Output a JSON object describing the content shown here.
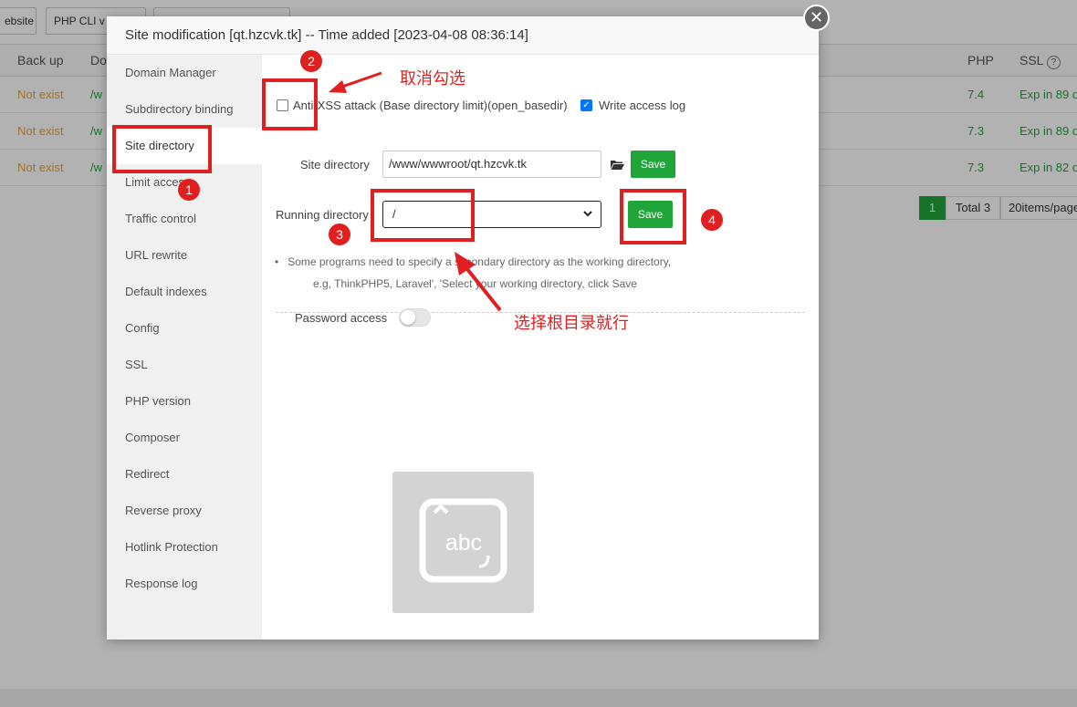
{
  "background": {
    "toolbar_buttons": [
      "ebsite",
      "PHP CLI v"
    ],
    "table_headers": [
      "Back up",
      "Do",
      "PHP",
      "SSL"
    ],
    "rows": [
      {
        "status": "Not exist",
        "dir": "/w",
        "php": "7.4",
        "ssl": "Exp in 89 d"
      },
      {
        "status": "Not exist",
        "dir": "/w",
        "php": "7.3",
        "ssl": "Exp in 89 d"
      },
      {
        "status": "Not exist",
        "dir": "/w",
        "php": "7.3",
        "ssl": "Exp in 82 d"
      }
    ],
    "pager": {
      "current": "1",
      "total": "Total 3",
      "page_size": "20items/page"
    }
  },
  "modal": {
    "title": "Site modification [qt.hzcvk.tk] -- Time added [2023-04-08 08:36:14]",
    "close_glyph": "✕",
    "sidebar": [
      "Domain Manager",
      "Subdirectory binding",
      "Site directory",
      "Limit access",
      "Traffic control",
      "URL rewrite",
      "Default indexes",
      "Config",
      "SSL",
      "PHP version",
      "Composer",
      "Redirect",
      "Reverse proxy",
      "Hotlink Protection",
      "Response log"
    ],
    "active_item": "Site directory",
    "anti_xss_label": "Anti-XSS attack (Base directory limit)(open_basedir)",
    "anti_xss_checked": false,
    "write_log_label": "Write access log",
    "write_log_checked": true,
    "site_directory_label": "Site directory",
    "site_directory_value": "/www/wwwroot/qt.hzcvk.tk",
    "save_label": "Save",
    "running_directory_label": "Running directory",
    "running_directory_value": "/",
    "tip_line1": "Some programs need to specify a secondary directory as the working directory,",
    "tip_line2": "e.g, ThinkPHP5, Laravel', 'Select your working directory, click Save",
    "password_access_label": "Password access",
    "password_access_on": false,
    "placeholder_image_text": "abc"
  },
  "annotations": {
    "numbers": [
      "1",
      "2",
      "3",
      "4"
    ],
    "text_uncheck": "取消勾选",
    "text_root": "选择根目录就行"
  },
  "colors": {
    "accent_green": "#20a53a",
    "annotation_red": "#e02020",
    "status_orange": "#e8a43c"
  }
}
